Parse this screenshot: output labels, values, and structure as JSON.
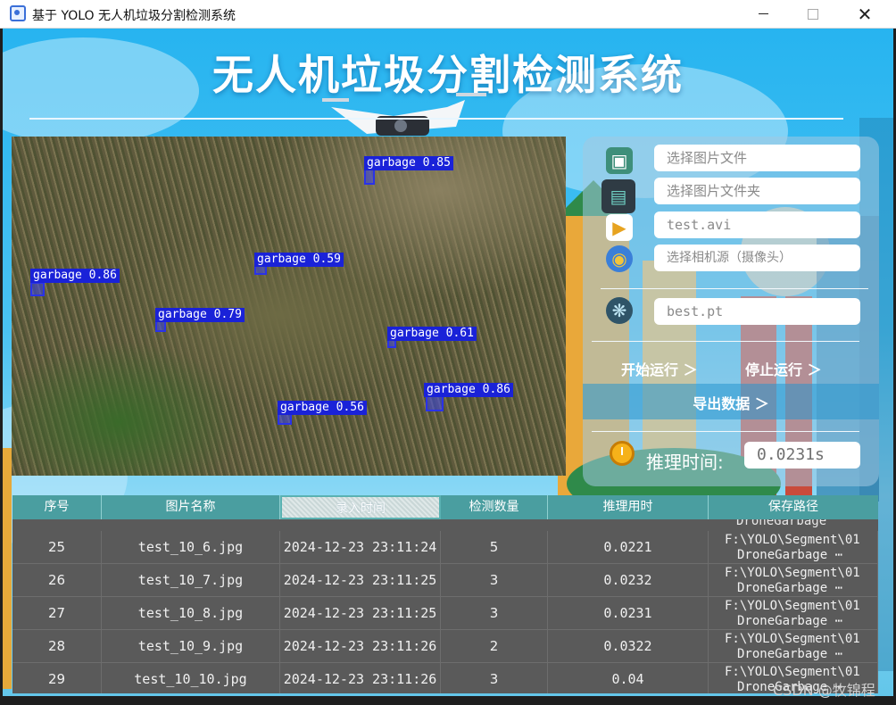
{
  "window": {
    "title": "基于 YOLO 无人机垃圾分割检测系统"
  },
  "app": {
    "title": "无人机垃圾分割检测系统"
  },
  "detections": [
    {
      "label": "garbage 0.85"
    },
    {
      "label": "garbage 0.86"
    },
    {
      "label": "garbage 0.59"
    },
    {
      "label": "garbage 0.79"
    },
    {
      "label": "garbage 0.61"
    },
    {
      "label": "garbage 0.86"
    },
    {
      "label": "garbage 0.56"
    }
  ],
  "controls": {
    "image_file_placeholder": "选择图片文件",
    "image_folder_placeholder": "选择图片文件夹",
    "video_file": "test.avi",
    "camera_placeholder": "选择相机源（摄像头）",
    "model_file": "best.pt",
    "start_label": "开始运行 ＞",
    "stop_label": "停止运行 ＞",
    "export_label": "导出数据 ＞",
    "infer_time_label": "推理时间:",
    "infer_time_value": "0.0231s"
  },
  "table": {
    "headers": [
      "序号",
      "图片名称",
      "录入时间",
      "检测数量",
      "推理用时",
      "保存路径"
    ],
    "top_partial": "DroneGarbage",
    "rows": [
      {
        "id": "25",
        "name": "test_10_6.jpg",
        "time": "2024-12-23 23:11:24",
        "count": "5",
        "infer": "0.0221",
        "path1": "F:\\YOLO\\Segment\\01",
        "path2": "DroneGarbage ⋯"
      },
      {
        "id": "26",
        "name": "test_10_7.jpg",
        "time": "2024-12-23 23:11:25",
        "count": "3",
        "infer": "0.0232",
        "path1": "F:\\YOLO\\Segment\\01",
        "path2": "DroneGarbage ⋯"
      },
      {
        "id": "27",
        "name": "test_10_8.jpg",
        "time": "2024-12-23 23:11:25",
        "count": "3",
        "infer": "0.0231",
        "path1": "F:\\YOLO\\Segment\\01",
        "path2": "DroneGarbage ⋯"
      },
      {
        "id": "28",
        "name": "test_10_9.jpg",
        "time": "2024-12-23 23:11:26",
        "count": "2",
        "infer": "0.0322",
        "path1": "F:\\YOLO\\Segment\\01",
        "path2": "DroneGarbage ⋯"
      },
      {
        "id": "29",
        "name": "test_10_10.jpg",
        "time": "2024-12-23 23:11:26",
        "count": "3",
        "infer": "0.04",
        "path1": "F:\\YOLO\\Segment\\01",
        "path2": "DroneGarbage ⋯"
      }
    ]
  },
  "watermark": "CSDN @牧锦程"
}
